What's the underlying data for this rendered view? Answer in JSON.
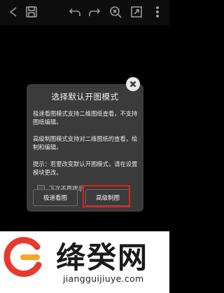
{
  "toolbar": {
    "icons": [
      "back-icon",
      "save-icon",
      "undo-icon",
      "redo-icon",
      "zoom-icon",
      "fullscreen-icon",
      "more-icon"
    ]
  },
  "dialog": {
    "title": "选择默认开图模式",
    "para1": "极速看图模式支持二维图纸查看，不支持图纸编辑。",
    "para2": "高级制图模式支持对二维图纸的查看，绘制和编辑。",
    "para3": "提示：若要改变默认开图模式，请在设置模块更改。",
    "checkbox_label": "下次不再提示",
    "btn_fast": "极速看图",
    "btn_advanced": "高级制图"
  },
  "watermark": {
    "name": "绛癸网",
    "url": "jiangguijiuye.com"
  },
  "colors": {
    "highlight": "#e0201a",
    "logo_red": "#e63a2e",
    "logo_orange": "#f5a623"
  }
}
